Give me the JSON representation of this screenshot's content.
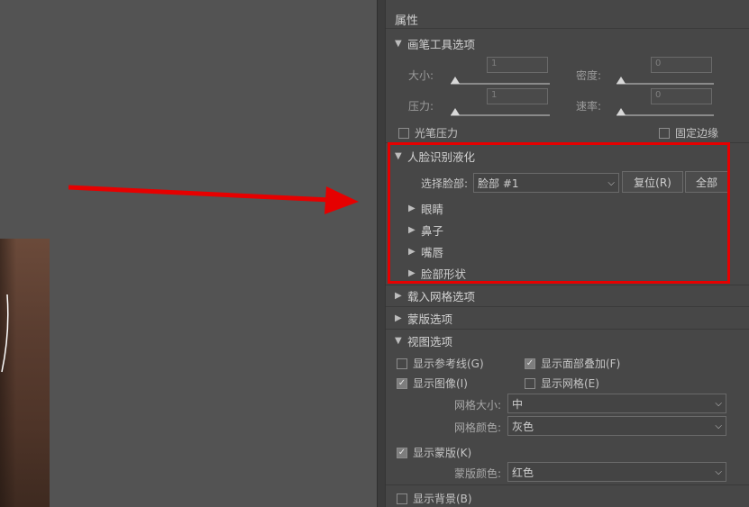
{
  "panel": {
    "title": "属性"
  },
  "brush": {
    "header": "画笔工具选项",
    "size_label": "大小:",
    "size_value": "1",
    "density_label": "密度:",
    "density_value": "0",
    "pressure_label": "压力:",
    "pressure_value": "1",
    "rate_label": "速率:",
    "rate_value": "0",
    "stylus_label": "光笔压力",
    "pin_edges_label": "固定边缘"
  },
  "face": {
    "header": "人脸识别液化",
    "select_face_label": "选择脸部:",
    "select_face_value": "脸部 #1",
    "reset_label": "复位(R)",
    "all_label": "全部",
    "items": [
      "眼睛",
      "鼻子",
      "嘴唇",
      "脸部形状"
    ]
  },
  "load_mesh": {
    "header": "载入网格选项"
  },
  "mask": {
    "header": "蒙版选项"
  },
  "view": {
    "header": "视图选项",
    "show_guides": "显示参考线(G)",
    "show_face_overlay": "显示面部叠加(F)",
    "show_image": "显示图像(I)",
    "show_mesh": "显示网格(E)",
    "mesh_size_label": "网格大小:",
    "mesh_size_value": "中",
    "mesh_color_label": "网格颜色:",
    "mesh_color_value": "灰色",
    "show_mask": "显示蒙版(K)",
    "mask_color_label": "蒙版颜色:",
    "mask_color_value": "红色",
    "show_backdrop": "显示背景(B)"
  },
  "colors": {
    "highlight": "#e60000",
    "arrow": "#e60000"
  }
}
